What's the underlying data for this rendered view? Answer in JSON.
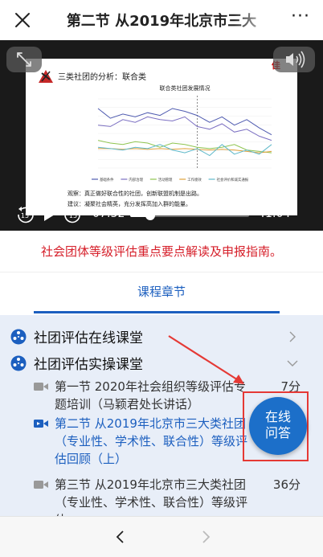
{
  "header": {
    "title": "第二节 从2019年北京市三大"
  },
  "video": {
    "slide": {
      "corner_text": "佳",
      "heading": "三类社团的分析：联合类",
      "chart_title": "联合类社团发展情况",
      "legend": [
        "基础条件",
        "内部治理",
        "活动管理",
        "工作绩效",
        "社会评价和诚实通报"
      ],
      "note_1": "观察：真正做好联合性的社团，创新联盟机制是出路。",
      "note_2": "建议：凝聚社会精英，充分发挥高加入群的能量。"
    },
    "current_time": "07:32",
    "remaining_time": "-41:04",
    "progress": 0.17,
    "skip_back_label": "15",
    "skip_forward_label": "15"
  },
  "subtitle": "社会团体等级评估重点要点解读及申报指南。",
  "tab": {
    "label": "课程章节"
  },
  "sections": [
    {
      "label": "社团评估在线课堂"
    },
    {
      "label": "社团评估实操课堂"
    }
  ],
  "lessons": [
    {
      "text": "第一节 2020年社会组织等级评估专题培训（马颖君处长讲话）",
      "duration": "7分"
    },
    {
      "text": "第二节 从2019年北京市三大类社团（专业性、学术性、联合性）等级评估回顾（上）",
      "duration": "分"
    },
    {
      "text": "第三节 从2019年北京市三大类社团（专业性、学术性、联合性）等级评估",
      "duration": "36分"
    }
  ],
  "fab": {
    "line1": "在线",
    "line2": "问答"
  },
  "colors": {
    "accent": "#1c5fbf",
    "subtitle_red": "#d61f2a",
    "list_bg": "#e8eef8",
    "annotation_red": "#e53935"
  },
  "chart_data": {
    "type": "line",
    "title": "联合类社团发展情况",
    "x": [
      1,
      2,
      3,
      4,
      5,
      6,
      7,
      8,
      9,
      10,
      11,
      12,
      13,
      14,
      15
    ],
    "ylim": [
      0,
      1
    ],
    "series": [
      {
        "name": "基础条件",
        "values": [
          0.86,
          0.72,
          0.78,
          0.74,
          0.8,
          0.76,
          0.86,
          0.82,
          0.76,
          0.66,
          0.74,
          0.62,
          0.7,
          0.58,
          0.48
        ]
      },
      {
        "name": "内部治理",
        "values": [
          0.62,
          0.6,
          0.7,
          0.66,
          0.74,
          0.7,
          0.68,
          0.74,
          0.6,
          0.56,
          0.64,
          0.52,
          0.56,
          0.46,
          0.4
        ]
      },
      {
        "name": "活动管理",
        "values": [
          0.4,
          0.36,
          0.34,
          0.38,
          0.36,
          0.3,
          0.36,
          0.34,
          0.3,
          0.28,
          0.3,
          0.34,
          0.26,
          0.24,
          0.22
        ]
      },
      {
        "name": "工作绩效",
        "values": [
          0.28,
          0.28,
          0.27,
          0.28,
          0.27,
          0.28,
          0.27,
          0.28,
          0.27,
          0.26,
          0.27,
          0.26,
          0.24,
          0.22,
          0.24
        ]
      },
      {
        "name": "社会评价和诚实通报",
        "values": [
          0.3,
          0.28,
          0.26,
          0.3,
          0.28,
          0.34,
          0.26,
          0.22,
          0.28,
          0.18,
          0.34,
          0.2,
          0.26,
          0.2,
          0.34
        ]
      }
    ]
  }
}
